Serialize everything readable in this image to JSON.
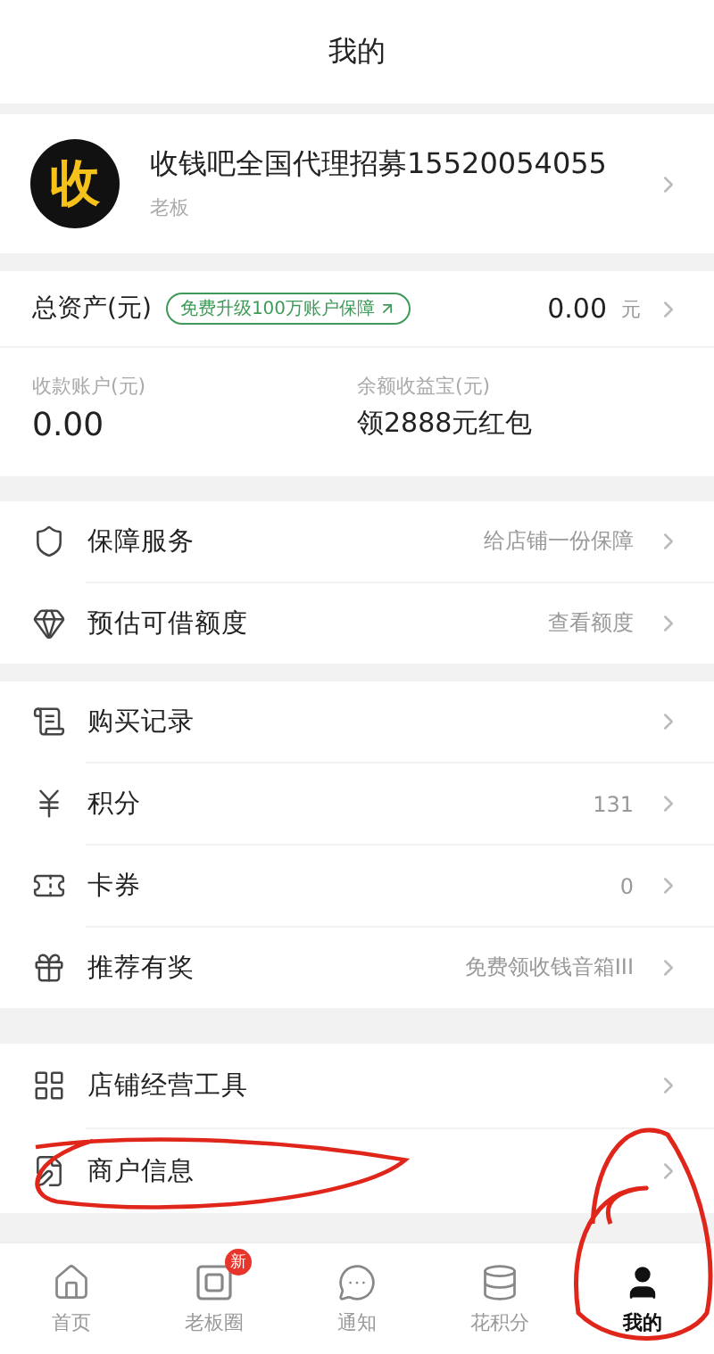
{
  "header": {
    "title": "我的"
  },
  "profile": {
    "avatar_text": "收",
    "name": "收钱吧全国代理招募15520054055",
    "role": "老板"
  },
  "assets": {
    "label": "总资产(元)",
    "promo": "免费升级100万账户保障",
    "amount": "0.00",
    "unit": "元",
    "cells": [
      {
        "label": "收款账户(元)",
        "value": "0.00"
      },
      {
        "label": "余额收益宝(元)",
        "value": "领2888元红包"
      }
    ]
  },
  "groups": [
    [
      {
        "label": "保障服务",
        "value": "给店铺一份保障",
        "circled": false
      },
      {
        "label": "预估可借额度",
        "value": "查看额度",
        "circled": false
      }
    ],
    [
      {
        "label": "购买记录",
        "circled": false
      },
      {
        "label": "积分",
        "value": "131",
        "circled": false
      },
      {
        "label": "卡券",
        "value": "0",
        "circled": false
      },
      {
        "label": "推荐有奖",
        "value": "免费领收钱音箱III",
        "circled": false
      }
    ],
    [
      {
        "label": "店铺经营工具",
        "circled": false
      },
      {
        "label": "商户信息",
        "circled": true
      }
    ]
  ],
  "tabs": [
    {
      "label": "首页",
      "selected": false,
      "circled": false
    },
    {
      "label": "老板圈",
      "selected": false,
      "badge": "新",
      "circled": false
    },
    {
      "label": "通知",
      "selected": false,
      "circled": false
    },
    {
      "label": "花积分",
      "selected": false,
      "circled": false
    },
    {
      "label": "我的",
      "selected": true,
      "circled": true
    }
  ]
}
